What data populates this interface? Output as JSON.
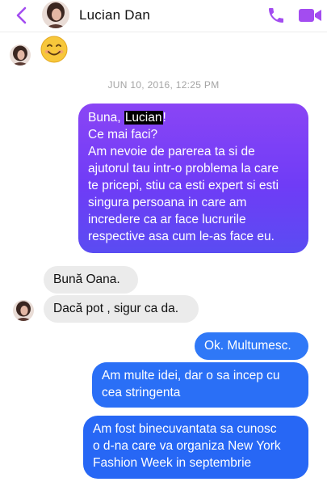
{
  "header": {
    "contact_name": "Lucian Dan",
    "back_icon": "chevron-left-icon",
    "call_icon": "phone-icon",
    "video_icon": "video-camera-icon",
    "accent_color": "#a34cf0"
  },
  "conversation": {
    "first_message_emoji": "😊",
    "timestamp": "JUN 10, 2016, 12:25 PM",
    "message_1": {
      "greeting_before": "Buna, ",
      "greeting_name": "Lucian",
      "greeting_after": "!",
      "lines": [
        "Ce mai faci?",
        "Am nevoie de parerea ta si de",
        "ajutorul tau intr-o problema la care",
        "te pricepi, stiu ca esti expert si esti",
        "singura persoana in care am",
        "incredere ca ar face lucrurile",
        "respective asa cum le-as face eu."
      ]
    },
    "message_2": "Bună  Oana.",
    "message_3": "Dacă pot , sigur ca da.",
    "message_4": "Ok. Multumesc.",
    "message_5": {
      "lines": [
        "Am multe idei, dar o sa incep cu",
        "cea stringenta"
      ]
    },
    "message_6": {
      "lines": [
        "Am fost binecuvantata sa cunosc",
        "o d-na care va organiza New York",
        "Fashion Week in septembrie"
      ]
    }
  }
}
